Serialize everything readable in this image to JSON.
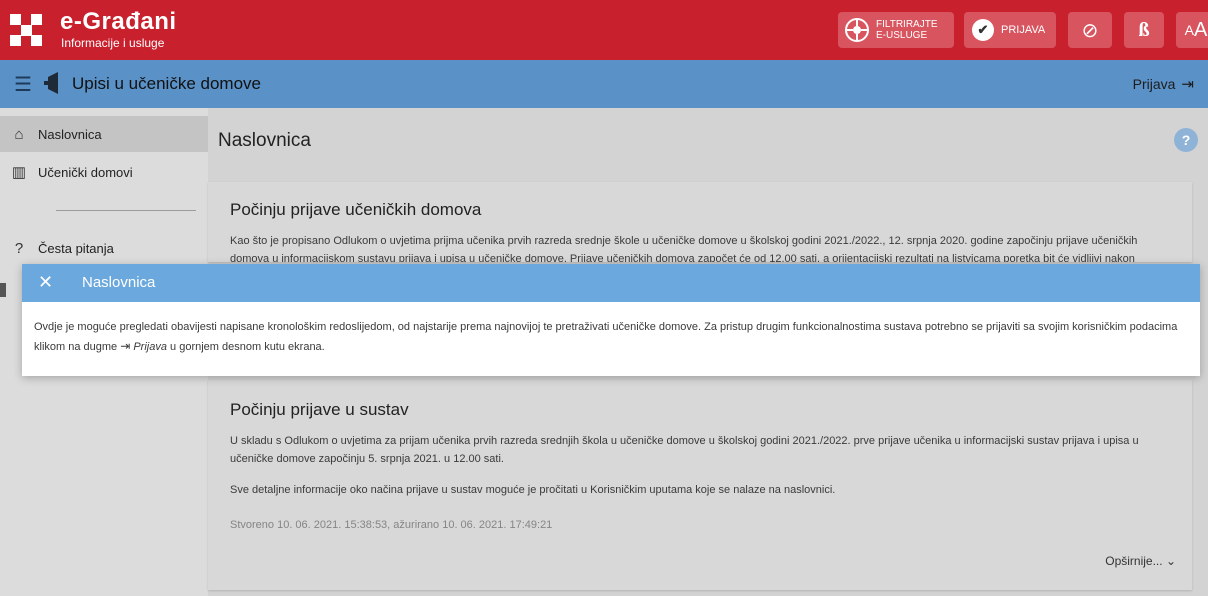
{
  "header": {
    "brand_title": "e-Građani",
    "brand_subtitle": "Informacije i usluge",
    "filter_line1": "FILTRIRAJTE",
    "filter_line2": "E-USLUGE",
    "login_label": "PRIJAVA",
    "font_size_label_small": "A",
    "font_size_label_big": "A",
    "dyslexia_label": "ß",
    "colors": {
      "red": "#c8202c",
      "blue": "#5a91c7",
      "modal_blue": "#6aa8dd"
    }
  },
  "subheader": {
    "app_title": "Upisi u učeničke domove",
    "login_label": "Prijava"
  },
  "sidebar": {
    "items": [
      {
        "label": "Naslovnica",
        "icon": "home-icon"
      },
      {
        "label": "Učenički domovi",
        "icon": "building-icon"
      },
      {
        "label": "Česta pitanja",
        "icon": "question-icon"
      }
    ]
  },
  "main": {
    "page_title": "Naslovnica",
    "cards": [
      {
        "title": "Počinju prijave učeničkih domova",
        "text1": "Kao što je propisano Odlukom o uvjetima prijma učenika prvih razreda srednje škole u učeničke domove u školskoj godini 2021./2022., 12. srpnja 2020. godine započinju prijave učeničkih",
        "text2": "domova u informacijskom sustavu prijava i upisa u učeničke domove. Prijave učeničkih domova započet će od 12.00 sati, a orijentacijski rezultati na listvicama poretka bit će vidljivi nakon"
      },
      {
        "title": "Počinju prijave u sustav",
        "text1": "U skladu s Odlukom o uvjetima za prijam učenika prvih razreda srednjih škola u učeničke domove u školskoj godini 2021./2022. prve prijave učenika u informacijski sustav prijava i upisa u učeničke domove započinju 5. srpnja 2021. u 12.00 sati.",
        "text2": "Sve detaljne informacije oko načina prijave u sustav moguće je pročitati u Korisničkim uputama koje se nalaze na naslovnici.",
        "meta": "Stvoreno 10. 06. 2021. 15:38:53, ažurirano 10. 06. 2021. 17:49:21",
        "more": "Opširnije..."
      }
    ]
  },
  "modal": {
    "title": "Naslovnica",
    "body_part1": "Ovdje je moguće pregledati obavijesti napisane kronološkim redoslijedom, od najstarije prema najnovijoj te pretraživati učeničke domove. Za pristup drugim funkcionalnostima sustava potrebno se prijaviti sa svojim korisničkim podacima klikom na dugme",
    "body_link": "Prijava",
    "body_part2": "u gornjem desnom kutu ekrana."
  }
}
